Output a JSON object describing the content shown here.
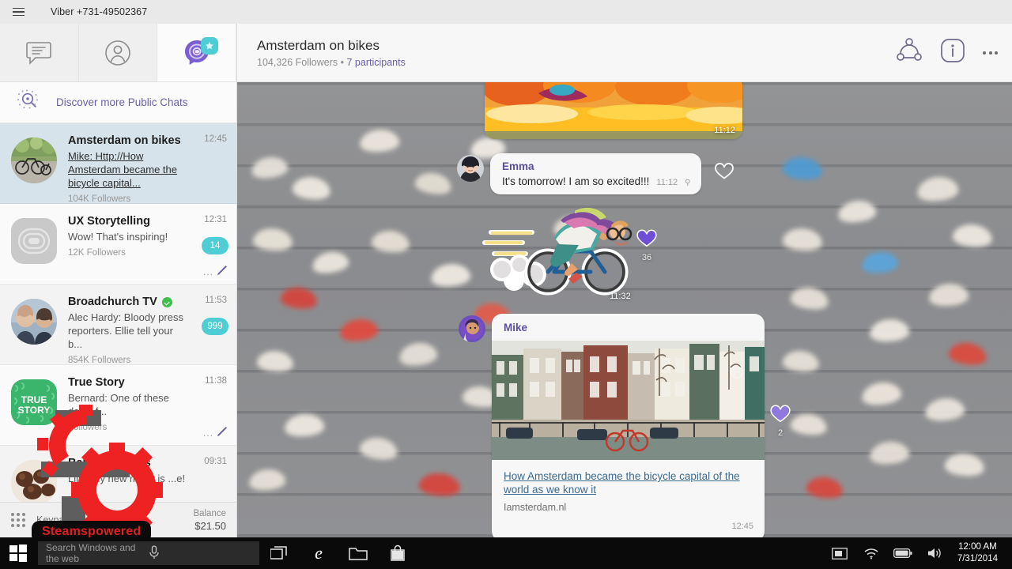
{
  "window": {
    "app_title": "Viber +731-49502367",
    "menu_icon": "hamburger-icon"
  },
  "sidebar": {
    "tabs": [
      {
        "name": "chats",
        "icon": "chat-bubble-icon",
        "active": false,
        "badge": ""
      },
      {
        "name": "contacts",
        "icon": "person-icon",
        "active": false,
        "badge": ""
      },
      {
        "name": "public-chats",
        "icon": "public-chat-icon",
        "active": true,
        "badge": "star"
      }
    ],
    "discover": {
      "label": "Discover more Public Chats",
      "icon": "sparkle-search-icon"
    },
    "chats": [
      {
        "name": "Amsterdam on bikes",
        "snippet": "Mike: Http://How Amsterdam became the bicycle capital...",
        "snippet_is_link": true,
        "followers": "104K Followers",
        "time": "12:45",
        "badge": "",
        "verified": false,
        "selected": true,
        "draft": false,
        "avatar": "bicycles-photo"
      },
      {
        "name": "UX Storytelling",
        "snippet": "Wow! That's inspiring!",
        "snippet_is_link": false,
        "followers": "12K Followers",
        "time": "12:31",
        "badge": "14",
        "verified": false,
        "selected": false,
        "draft": true,
        "avatar": "ux-logo"
      },
      {
        "name": "Broadchurch TV",
        "snippet": "Alec Hardy: Bloody press reporters. Ellie tell your b...",
        "snippet_is_link": false,
        "followers": "854K Followers",
        "time": "11:53",
        "badge": "999",
        "verified": true,
        "selected": false,
        "draft": false,
        "avatar": "broadchurch-photo"
      },
      {
        "name": "True Story",
        "snippet": "Bernard: One of these days, f...",
        "snippet_is_link": false,
        "followers": "Followers",
        "time": "11:38",
        "badge": "",
        "verified": false,
        "selected": false,
        "draft": true,
        "avatar": "true-story-logo"
      },
      {
        "name": "Baking Secrets",
        "snippet": "Lilly: My new mixer is ...e!",
        "snippet_is_link": false,
        "followers": "",
        "time": "09:31",
        "badge": "",
        "verified": false,
        "selected": false,
        "draft": false,
        "avatar": "cupcakes-photo"
      }
    ],
    "bottom": {
      "keypad_label": "Keypad",
      "balance_label": "Balance",
      "balance_value": "$21.50"
    }
  },
  "chat_header": {
    "title": "Amsterdam on bikes",
    "followers": "104,326 Followers",
    "separator": " • ",
    "participants": "7 participants",
    "actions": [
      {
        "name": "share-icon"
      },
      {
        "name": "info-icon",
        "label": "i"
      },
      {
        "name": "more-options-icon"
      }
    ]
  },
  "conversation": {
    "messages": [
      {
        "type": "photo",
        "name": "cheese-photo-message",
        "time": "11:12"
      },
      {
        "type": "text",
        "sender": "Emma",
        "text": "It's tomorrow! I am so excited!!!",
        "time": "11:12",
        "seen_marker": "⚲",
        "reaction_icon": "heart-outline-icon"
      },
      {
        "type": "sticker",
        "name": "cyclist-sticker",
        "time": "11:32",
        "reaction_icon": "heart-filled-icon",
        "reaction_count": "36"
      },
      {
        "type": "link-preview",
        "sender": "Mike",
        "preview_title": "How Amsterdam became the bicycle capital of the world as we know it",
        "preview_host": "Iamsterdam.nl",
        "time": "12:45",
        "reaction_icon": "heart-filled-icon",
        "reaction_count": "2"
      }
    ]
  },
  "watermark": {
    "label": "Steamspowered",
    "icon": "gear-logo",
    "color": "#e02020"
  },
  "taskbar": {
    "start_icon": "windows-start-icon",
    "search_placeholder": "Search Windows and the web",
    "search_value": "",
    "mic_icon": "microphone-icon",
    "items": [
      {
        "name": "task-view-icon"
      },
      {
        "name": "edge-browser-icon"
      },
      {
        "name": "file-explorer-icon"
      },
      {
        "name": "store-icon"
      }
    ],
    "tray": [
      {
        "name": "ime-keyboard-icon"
      },
      {
        "name": "wifi-icon"
      },
      {
        "name": "battery-icon"
      },
      {
        "name": "volume-icon"
      }
    ],
    "clock_time": "12:00 AM",
    "clock_date": "7/31/2014"
  },
  "colors": {
    "accent_purple": "#6b5fa8",
    "badge_teal": "#4ecdd4",
    "verified_green": "#3fbf4c",
    "link_blue": "#3d6b8e"
  }
}
